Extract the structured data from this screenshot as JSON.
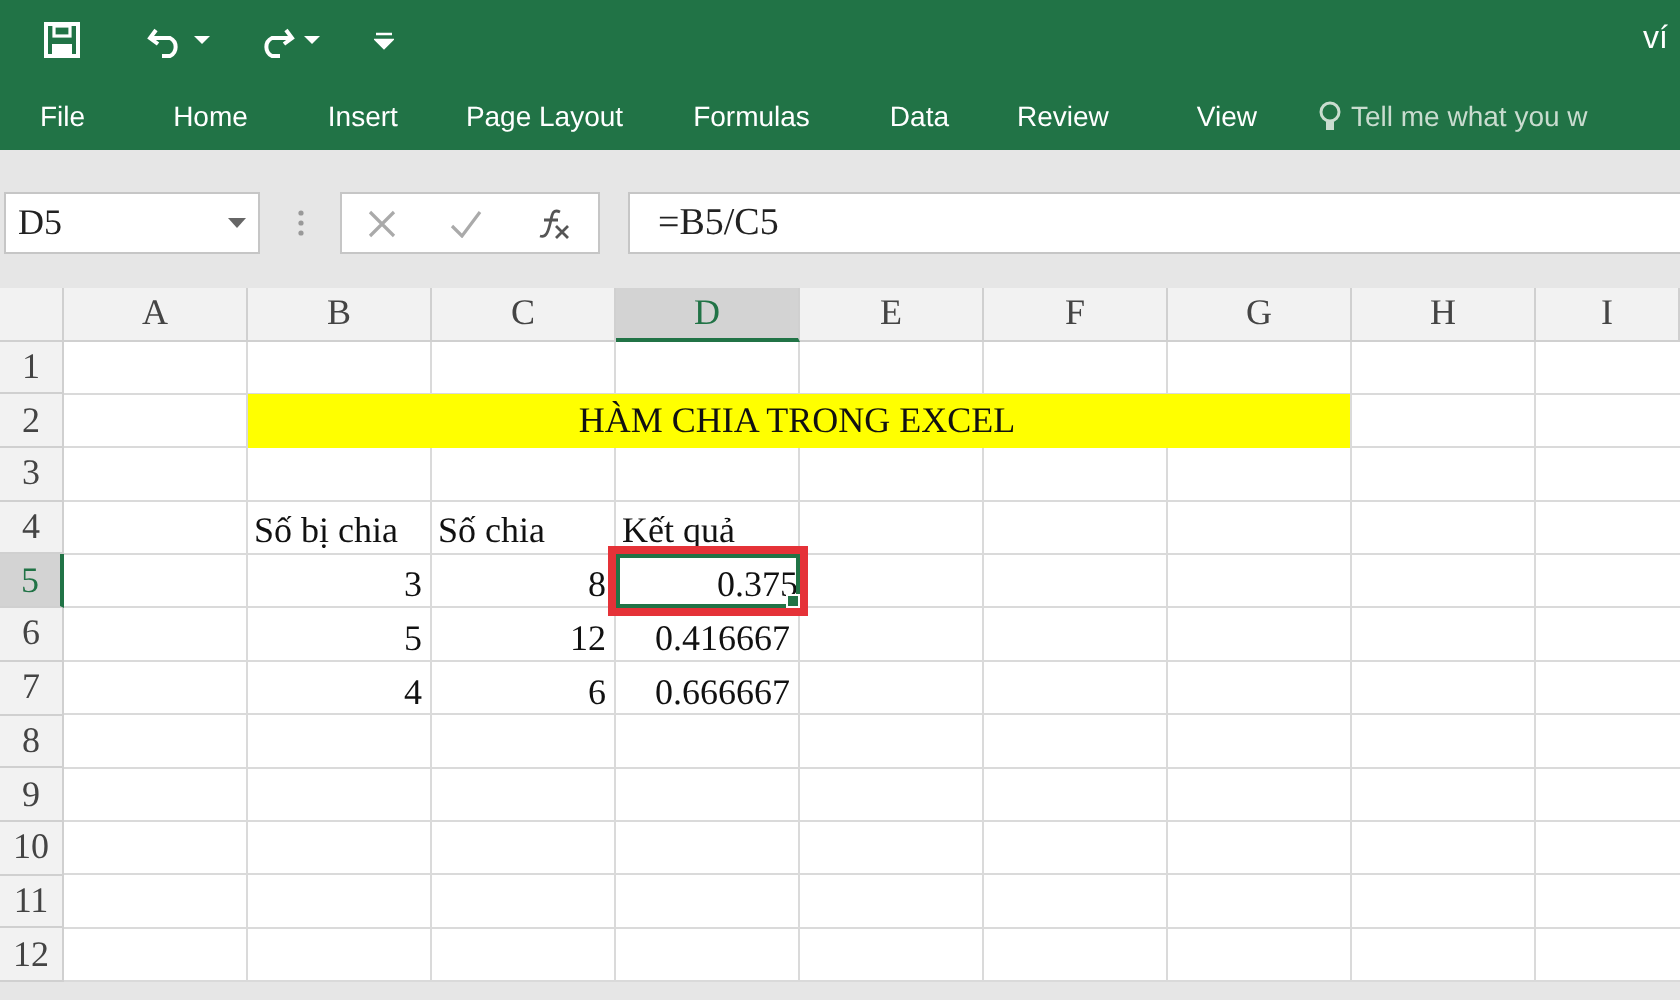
{
  "title_bar": {
    "title": "ví"
  },
  "ribbon_tabs": [
    "File",
    "Home",
    "Insert",
    "Page Layout",
    "Formulas",
    "Data",
    "Review",
    "View"
  ],
  "tell_me": {
    "placeholder": "Tell me what you w"
  },
  "formula_bar": {
    "name_box": "D5",
    "formula": "=B5/C5"
  },
  "columns": [
    {
      "label": "A",
      "selected": false
    },
    {
      "label": "B",
      "selected": false
    },
    {
      "label": "C",
      "selected": false
    },
    {
      "label": "D",
      "selected": true
    },
    {
      "label": "E",
      "selected": false
    },
    {
      "label": "F",
      "selected": false
    },
    {
      "label": "G",
      "selected": false
    },
    {
      "label": "H",
      "selected": false
    },
    {
      "label": "I",
      "selected": false
    }
  ],
  "rows": [
    {
      "label": "1",
      "selected": false
    },
    {
      "label": "2",
      "selected": false,
      "cells": [
        {
          "kind": "empty"
        },
        {
          "kind": "banner",
          "text": "HÀM CHIA TRONG EXCEL"
        }
      ]
    },
    {
      "label": "3",
      "selected": false
    },
    {
      "label": "4",
      "selected": false,
      "cells": [
        {
          "kind": "empty"
        },
        {
          "kind": "label",
          "text": "Số bị chia",
          "circled": false
        },
        {
          "kind": "label",
          "text": "Số chia",
          "circled": false
        },
        {
          "kind": "label",
          "text": "Kết quả",
          "circled": false
        }
      ]
    },
    {
      "label": "5",
      "selected": true,
      "cells": [
        {
          "kind": "empty"
        },
        {
          "kind": "number",
          "text": "3",
          "circled": false
        },
        {
          "kind": "number",
          "text": "8",
          "circled": false
        },
        {
          "kind": "number",
          "text": "0.375",
          "circled": true
        }
      ]
    },
    {
      "label": "6",
      "selected": false,
      "cells": [
        {
          "kind": "empty"
        },
        {
          "kind": "number",
          "text": "5",
          "circled": false
        },
        {
          "kind": "number",
          "text": "12",
          "circled": false
        },
        {
          "kind": "number",
          "text": "0.416667",
          "circled": false
        }
      ]
    },
    {
      "label": "7",
      "selected": false,
      "cells": [
        {
          "kind": "empty"
        },
        {
          "kind": "number",
          "text": "4",
          "circled": false
        },
        {
          "kind": "number",
          "text": "6",
          "circled": false
        },
        {
          "kind": "number",
          "text": "0.666667",
          "circled": false
        }
      ]
    },
    {
      "label": "8",
      "selected": false
    },
    {
      "label": "9",
      "selected": false
    },
    {
      "label": "10",
      "selected": false
    },
    {
      "label": "11",
      "selected": false
    },
    {
      "label": "12",
      "selected": false
    }
  ]
}
